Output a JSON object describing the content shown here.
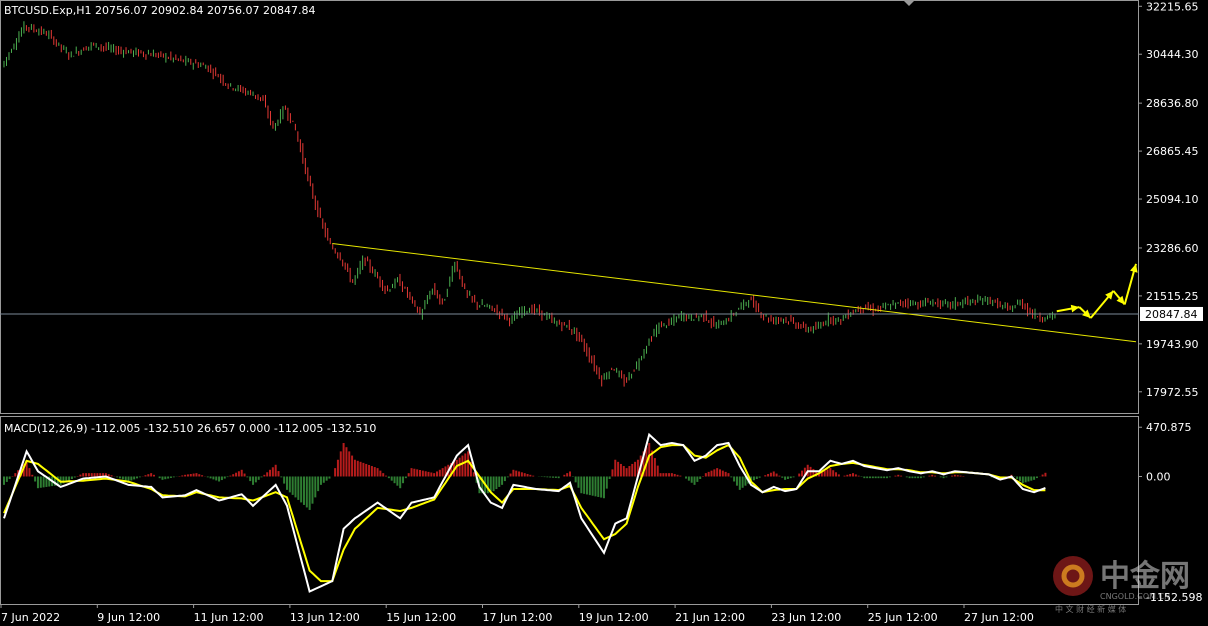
{
  "chart_data": [
    {
      "type": "candlestick",
      "header": "BTCUSD.Exp,H1  20756.07 20902.84 20756.07 20847.84",
      "y_ticks": [
        "32215.65",
        "30444.30",
        "28636.80",
        "26865.45",
        "25094.10",
        "23286.60",
        "21515.25",
        "19743.90",
        "17972.55"
      ],
      "y_tick_values": [
        32215.65,
        30444.3,
        28636.8,
        26865.45,
        25094.1,
        23286.6,
        21515.25,
        19743.9,
        17972.55
      ],
      "ylim": [
        17300,
        32300
      ],
      "current_price_label": "20847.84",
      "current_price": 20847.84,
      "x_ticks": [
        "7 Jun 2022",
        "9 Jun 12:00",
        "11 Jun 12:00",
        "13 Jun 12:00",
        "15 Jun 12:00",
        "17 Jun 12:00",
        "19 Jun 12:00",
        "21 Jun 12:00",
        "23 Jun 12:00",
        "25 Jun 12:00",
        "27 Jun 12:00"
      ],
      "price_path": [
        [
          0,
          30000
        ],
        [
          2,
          31500
        ],
        [
          4,
          31200
        ],
        [
          6,
          30400
        ],
        [
          8,
          30800
        ],
        [
          10,
          30600
        ],
        [
          12,
          30500
        ],
        [
          14,
          30400
        ],
        [
          16,
          30200
        ],
        [
          18,
          30000
        ],
        [
          19,
          29700
        ],
        [
          20,
          29300
        ],
        [
          22,
          29000
        ],
        [
          23,
          28800
        ],
        [
          24,
          27700
        ],
        [
          25,
          28500
        ],
        [
          26,
          27600
        ],
        [
          27,
          25900
        ],
        [
          28,
          24500
        ],
        [
          29,
          23400
        ],
        [
          30,
          22900
        ],
        [
          31,
          22000
        ],
        [
          32,
          22900
        ],
        [
          33,
          22300
        ],
        [
          34,
          21700
        ],
        [
          35,
          22100
        ],
        [
          36,
          21500
        ],
        [
          37,
          20800
        ],
        [
          38,
          21800
        ],
        [
          39,
          21200
        ],
        [
          40,
          22800
        ],
        [
          41,
          21600
        ],
        [
          42,
          21200
        ],
        [
          43,
          21100
        ],
        [
          44,
          20900
        ],
        [
          45,
          20600
        ],
        [
          46,
          21000
        ],
        [
          47,
          21000
        ],
        [
          48,
          20800
        ],
        [
          49,
          20500
        ],
        [
          50,
          20400
        ],
        [
          51,
          20000
        ],
        [
          52,
          19200
        ],
        [
          53,
          18400
        ],
        [
          54,
          18900
        ],
        [
          55,
          18300
        ],
        [
          56,
          18900
        ],
        [
          57,
          19700
        ],
        [
          58,
          20400
        ],
        [
          59,
          20500
        ],
        [
          60,
          20800
        ],
        [
          61,
          20700
        ],
        [
          62,
          20800
        ],
        [
          63,
          20400
        ],
        [
          64,
          20600
        ],
        [
          65,
          21000
        ],
        [
          66,
          21400
        ],
        [
          67,
          20900
        ],
        [
          68,
          20600
        ],
        [
          69,
          20700
        ],
        [
          70,
          20500
        ],
        [
          71,
          20300
        ],
        [
          72,
          20300
        ],
        [
          73,
          20700
        ],
        [
          74,
          20600
        ],
        [
          75,
          20900
        ],
        [
          76,
          21100
        ],
        [
          77,
          21000
        ],
        [
          78,
          21100
        ],
        [
          79,
          21200
        ],
        [
          80,
          21300
        ],
        [
          81,
          21200
        ],
        [
          82,
          21300
        ],
        [
          83,
          21200
        ],
        [
          84,
          21200
        ],
        [
          85,
          21300
        ],
        [
          86,
          21300
        ],
        [
          87,
          21400
        ],
        [
          88,
          21200
        ],
        [
          89,
          21000
        ],
        [
          90,
          21300
        ],
        [
          91,
          20850
        ],
        [
          92,
          20700
        ],
        [
          93,
          20800
        ]
      ],
      "trendline": {
        "from": [
          29,
          23450
        ],
        "to": [
          100,
          19820
        ],
        "color": "#e6e600"
      },
      "forecast_arrows_color": "#ffff00",
      "forecast_path": [
        [
          93,
          20950
        ],
        [
          95,
          21100
        ],
        [
          96,
          20700
        ],
        [
          98,
          21700
        ],
        [
          99,
          21200
        ],
        [
          100,
          22700
        ]
      ],
      "bull_color": "#4caf50",
      "bear_color": "#e53935"
    },
    {
      "type": "line",
      "title": "MACD(12,26,9) -112.005 -132.510 26.657 0.000 -112.005 -132.510",
      "y_ticks": [
        "470.875",
        "0.00",
        "-1152.598"
      ],
      "y_tick_values": [
        470.875,
        0.0,
        -1152.598
      ],
      "ylim": [
        -1200,
        540
      ],
      "macd_path": [
        [
          0,
          -400
        ],
        [
          2,
          240
        ],
        [
          3,
          50
        ],
        [
          5,
          -100
        ],
        [
          7,
          -20
        ],
        [
          9,
          0
        ],
        [
          11,
          -80
        ],
        [
          13,
          -100
        ],
        [
          14,
          -200
        ],
        [
          16,
          -180
        ],
        [
          17,
          -130
        ],
        [
          19,
          -230
        ],
        [
          21,
          -170
        ],
        [
          22,
          -280
        ],
        [
          24,
          -80
        ],
        [
          25,
          -280
        ],
        [
          27,
          -1100
        ],
        [
          28,
          -1050
        ],
        [
          29,
          -1000
        ],
        [
          30,
          -500
        ],
        [
          31,
          -400
        ],
        [
          33,
          -250
        ],
        [
          35,
          -400
        ],
        [
          36,
          -250
        ],
        [
          38,
          -200
        ],
        [
          40,
          200
        ],
        [
          41,
          300
        ],
        [
          42,
          -100
        ],
        [
          43,
          -250
        ],
        [
          44,
          -300
        ],
        [
          45,
          -80
        ],
        [
          47,
          -120
        ],
        [
          49,
          -140
        ],
        [
          50,
          -60
        ],
        [
          51,
          -400
        ],
        [
          53,
          -730
        ],
        [
          54,
          -450
        ],
        [
          55,
          -400
        ],
        [
          56,
          0
        ],
        [
          57,
          400
        ],
        [
          58,
          300
        ],
        [
          59,
          320
        ],
        [
          60,
          300
        ],
        [
          61,
          150
        ],
        [
          62,
          200
        ],
        [
          63,
          300
        ],
        [
          64,
          320
        ],
        [
          65,
          100
        ],
        [
          66,
          -80
        ],
        [
          67,
          -150
        ],
        [
          68,
          -100
        ],
        [
          69,
          -140
        ],
        [
          70,
          -120
        ],
        [
          71,
          50
        ],
        [
          72,
          50
        ],
        [
          73,
          150
        ],
        [
          74,
          120
        ],
        [
          75,
          150
        ],
        [
          76,
          100
        ],
        [
          77,
          80
        ],
        [
          78,
          60
        ],
        [
          79,
          80
        ],
        [
          80,
          50
        ],
        [
          81,
          30
        ],
        [
          82,
          50
        ],
        [
          83,
          20
        ],
        [
          84,
          50
        ],
        [
          85,
          40
        ],
        [
          86,
          30
        ],
        [
          87,
          20
        ],
        [
          88,
          -30
        ],
        [
          89,
          0
        ],
        [
          90,
          -120
        ],
        [
          91,
          -150
        ],
        [
          92,
          -110
        ]
      ],
      "signal_path": [
        [
          0,
          -350
        ],
        [
          2,
          150
        ],
        [
          3,
          120
        ],
        [
          5,
          -50
        ],
        [
          7,
          -40
        ],
        [
          9,
          -20
        ],
        [
          11,
          -50
        ],
        [
          13,
          -120
        ],
        [
          14,
          -180
        ],
        [
          16,
          -190
        ],
        [
          17,
          -150
        ],
        [
          19,
          -200
        ],
        [
          21,
          -210
        ],
        [
          22,
          -230
        ],
        [
          24,
          -150
        ],
        [
          25,
          -200
        ],
        [
          27,
          -900
        ],
        [
          28,
          -1000
        ],
        [
          29,
          -1000
        ],
        [
          30,
          -700
        ],
        [
          31,
          -500
        ],
        [
          33,
          -300
        ],
        [
          35,
          -330
        ],
        [
          36,
          -300
        ],
        [
          38,
          -220
        ],
        [
          40,
          100
        ],
        [
          41,
          150
        ],
        [
          42,
          0
        ],
        [
          43,
          -150
        ],
        [
          44,
          -250
        ],
        [
          45,
          -120
        ],
        [
          47,
          -120
        ],
        [
          49,
          -130
        ],
        [
          50,
          -90
        ],
        [
          51,
          -300
        ],
        [
          53,
          -600
        ],
        [
          54,
          -550
        ],
        [
          55,
          -450
        ],
        [
          56,
          -100
        ],
        [
          57,
          200
        ],
        [
          58,
          280
        ],
        [
          59,
          300
        ],
        [
          60,
          300
        ],
        [
          61,
          200
        ],
        [
          62,
          180
        ],
        [
          63,
          250
        ],
        [
          64,
          300
        ],
        [
          65,
          180
        ],
        [
          66,
          -50
        ],
        [
          67,
          -150
        ],
        [
          68,
          -130
        ],
        [
          69,
          -120
        ],
        [
          70,
          -120
        ],
        [
          71,
          -20
        ],
        [
          72,
          30
        ],
        [
          73,
          100
        ],
        [
          74,
          120
        ],
        [
          75,
          130
        ],
        [
          76,
          110
        ],
        [
          77,
          90
        ],
        [
          78,
          70
        ],
        [
          79,
          70
        ],
        [
          80,
          60
        ],
        [
          81,
          40
        ],
        [
          82,
          40
        ],
        [
          83,
          30
        ],
        [
          84,
          40
        ],
        [
          85,
          40
        ],
        [
          86,
          30
        ],
        [
          87,
          20
        ],
        [
          88,
          -10
        ],
        [
          89,
          -10
        ],
        [
          90,
          -80
        ],
        [
          91,
          -130
        ],
        [
          92,
          -132
        ]
      ],
      "macd_color": "#ffffff",
      "signal_color": "#ffff00",
      "hist_pos_color": "#b71c1c",
      "hist_neg_color": "#2e7d32"
    }
  ],
  "watermark": {
    "name": "中金网",
    "sub": "中 文 财 经 新 媒 体",
    "domain": "CNGOLD.COM.CN"
  }
}
